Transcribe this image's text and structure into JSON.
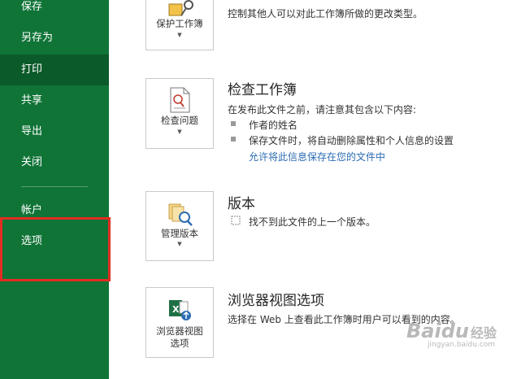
{
  "sidebar": {
    "items": [
      {
        "label": "保存"
      },
      {
        "label": "另存为"
      },
      {
        "label": "打印"
      },
      {
        "label": "共享"
      },
      {
        "label": "导出"
      },
      {
        "label": "关闭"
      },
      {
        "label": "帐户"
      },
      {
        "label": "选项"
      }
    ],
    "active_item": "打印",
    "color": "#107437",
    "active_color": "#0b5a2a",
    "highlight_color": "#e22d22"
  },
  "protect": {
    "button_label": "保护工作簿",
    "description": "控制其他人可以对此工作簿所做的更改类型。"
  },
  "inspect": {
    "button_label": "检查问题",
    "title": "检查工作簿",
    "description": "在发布此文件之前，请注意其包含以下内容:",
    "bullets": [
      "作者的姓名",
      "保存文件时，将自动删除属性和个人信息的设置"
    ],
    "link": "允许将此信息保存在您的文件中"
  },
  "versions": {
    "button_label": "管理版本",
    "title": "版本",
    "description": "找不到此文件的上一个版本。"
  },
  "browser": {
    "button_label_line1": "浏览器视图",
    "button_label_line2": "选项",
    "title": "浏览器视图选项",
    "description": "选择在 Web 上查看此工作簿时用户可以看到的内容。"
  },
  "watermark": {
    "brand": "Baidu",
    "brand_cn": "经验",
    "url": "jingyan.baidu.com"
  }
}
